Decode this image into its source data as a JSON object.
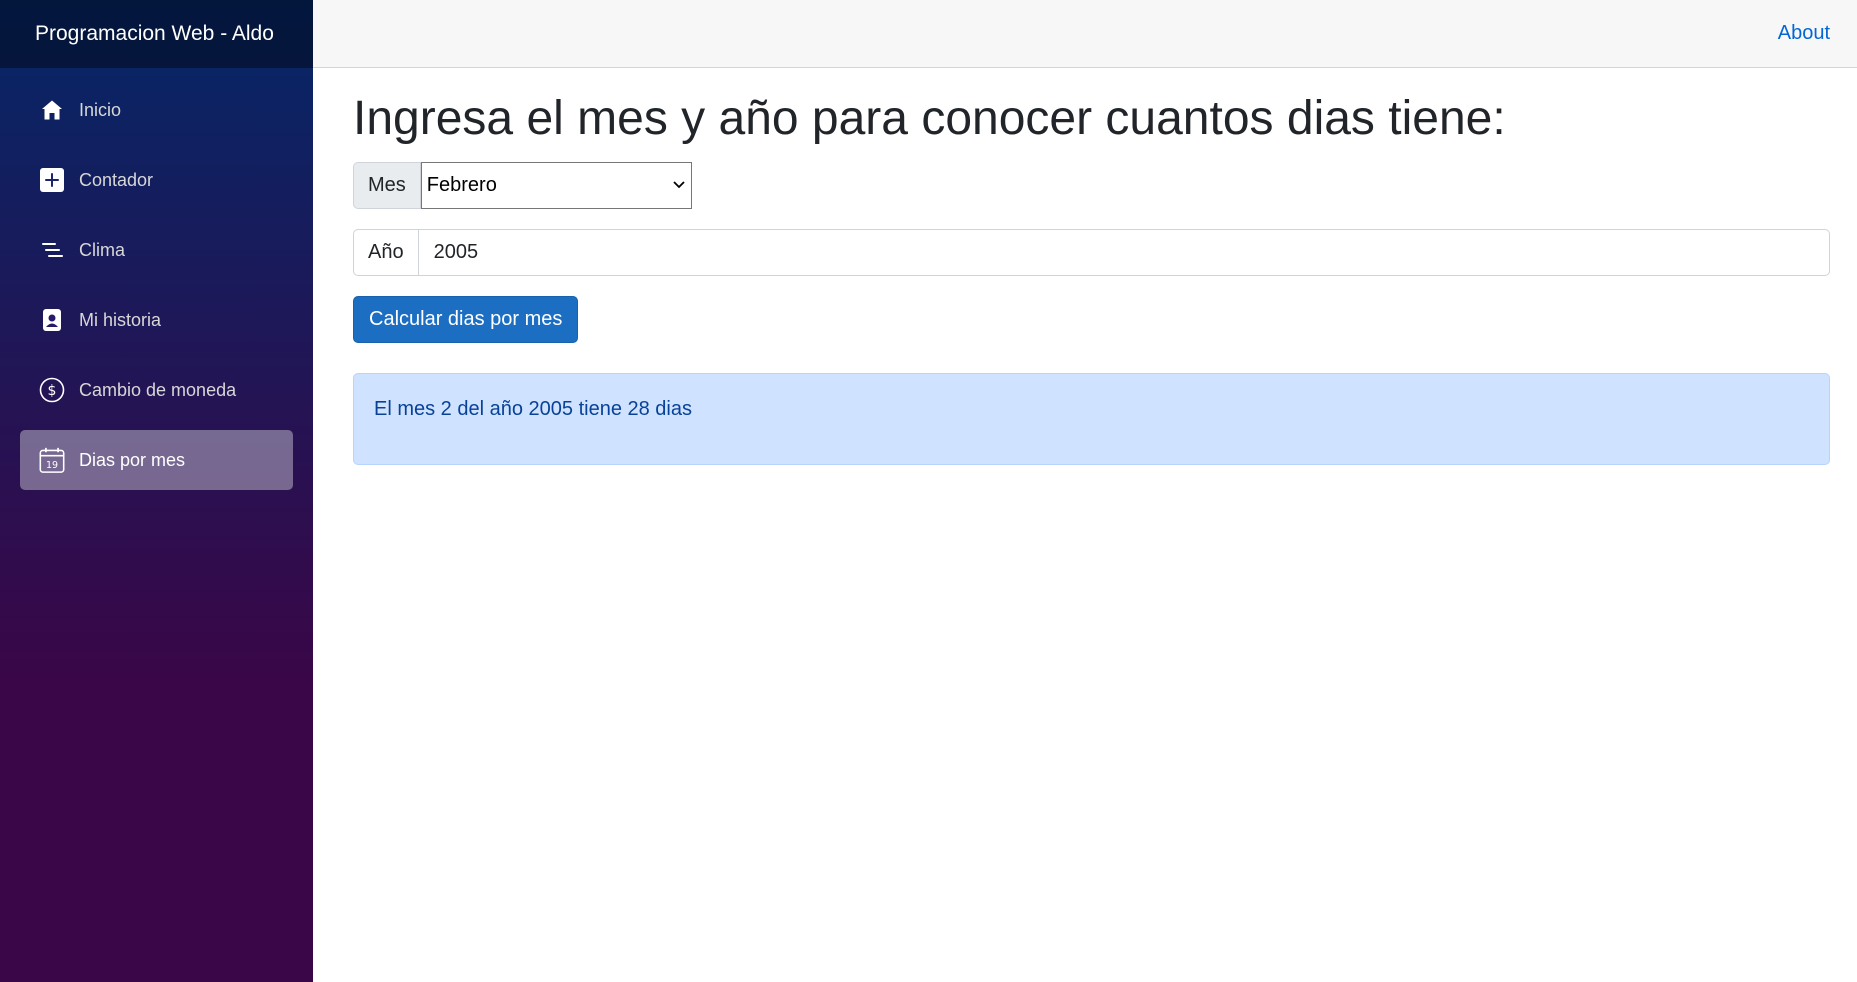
{
  "sidebar": {
    "brand": "Programacion Web - Aldo",
    "items": [
      {
        "label": "Inicio",
        "icon": "home-icon"
      },
      {
        "label": "Contador",
        "icon": "plus-square-icon"
      },
      {
        "label": "Clima",
        "icon": "list-icon"
      },
      {
        "label": "Mi historia",
        "icon": "person-badge-icon"
      },
      {
        "label": "Cambio de moneda",
        "icon": "dollar-circle-icon"
      },
      {
        "label": "Dias por mes",
        "icon": "calendar-icon",
        "active": true
      }
    ],
    "calendar_day": "19"
  },
  "header": {
    "about_link": "About"
  },
  "main": {
    "title": "Ingresa el mes y año para conocer cuantos dias tiene:",
    "month_label": "Mes",
    "month_value": "Febrero",
    "year_label": "Año",
    "year_value": "2005",
    "button_label": "Calcular dias por mes",
    "result": "El mes 2 del año 2005 tiene 28 dias"
  },
  "colors": {
    "accent": "#1b6ec2",
    "link": "#0366d6",
    "alert_bg": "#cfe2ff",
    "alert_text": "#084298",
    "sidebar_top": "#052767",
    "sidebar_bottom": "#3a0647"
  }
}
